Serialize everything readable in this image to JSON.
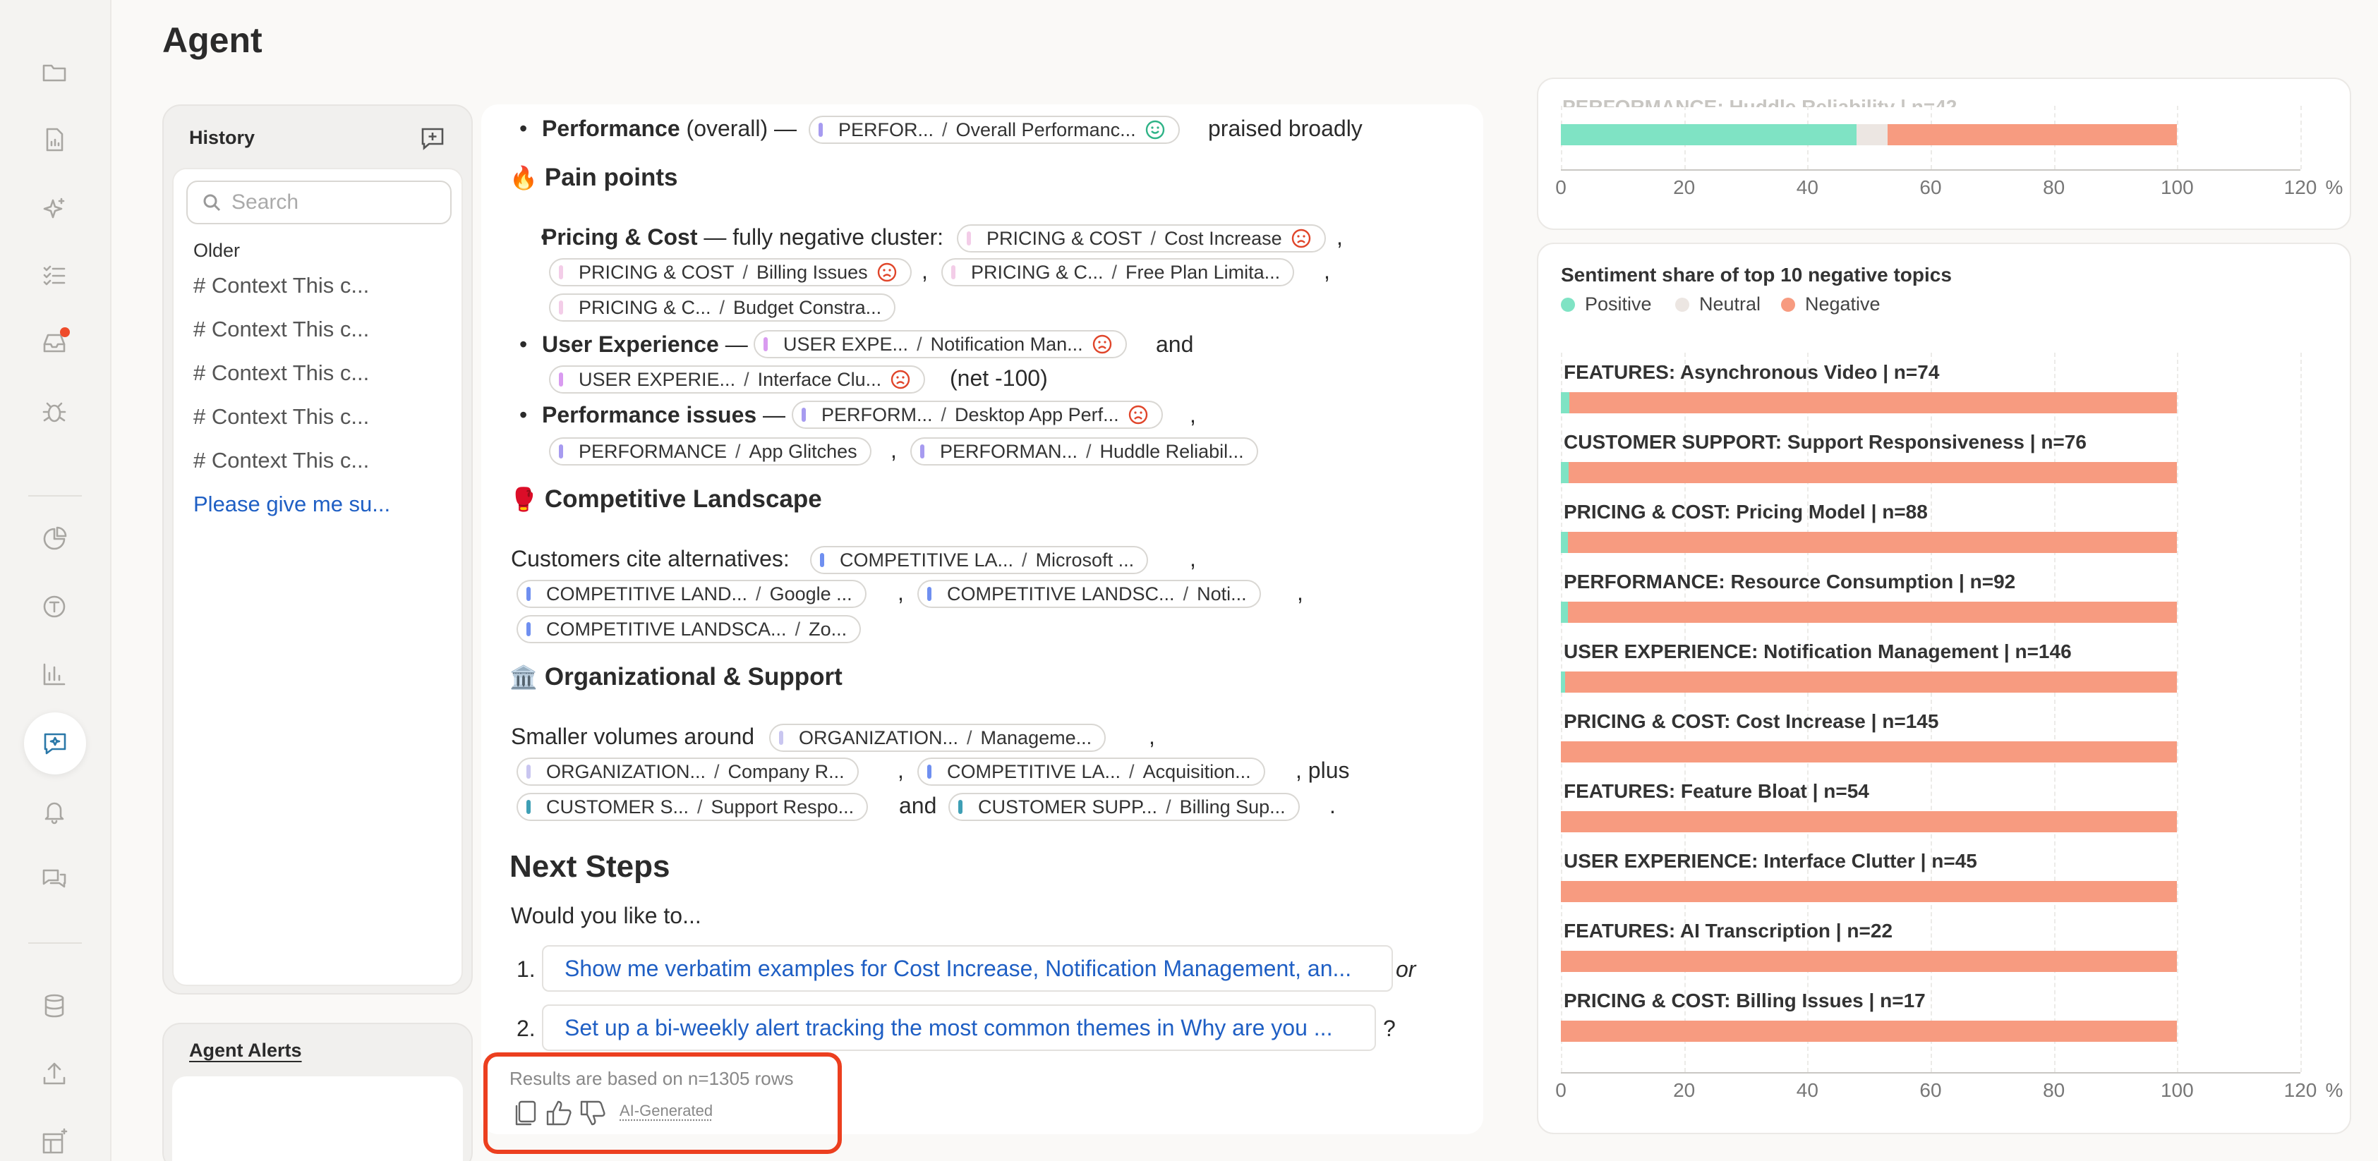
{
  "page_title": "Agent",
  "rail": {
    "icons": [
      "folder-icon",
      "document-chart-icon",
      "sparkles-icon",
      "checklist-icon",
      "inbox-icon",
      "bug-icon",
      "pie-chart-icon",
      "topic-icon",
      "bar-chart-icon",
      "agent-chat-icon",
      "bell-icon",
      "chat-bubbles-icon",
      "database-icon",
      "upload-icon",
      "layout-sparkle-icon"
    ],
    "active": "agent-chat-icon"
  },
  "history": {
    "title": "History",
    "search_placeholder": "Search",
    "group_label": "Older",
    "items": [
      "# Context This c...",
      "# Context This c...",
      "# Context This c...",
      "# Context This c...",
      "# Context This c..."
    ],
    "link_item": "Please give me su..."
  },
  "alerts": {
    "title": "Agent Alerts"
  },
  "chat": {
    "perf_line": {
      "bullet": "Performance",
      "rest": "(overall) —",
      "chip": {
        "category": "PERFOR...",
        "topic": "Overall Performanc...",
        "sentiment": "positive"
      },
      "after": "praised broadly"
    },
    "pain_heading": {
      "emoji": "🔥",
      "text": "Pain points"
    },
    "pricing": {
      "lead": "Pricing & Cost",
      "rest": "— fully negative cluster:",
      "chips": [
        {
          "category": "PRICING & COST",
          "topic": "Cost Increase",
          "sentiment": "negative"
        },
        {
          "category": "PRICING & COST",
          "topic": "Billing Issues",
          "sentiment": "negative"
        },
        {
          "category": "PRICING & C...",
          "topic": "Free Plan Limita...",
          "sentiment": ""
        },
        {
          "category": "PRICING & C...",
          "topic": "Budget Constra...",
          "sentiment": ""
        }
      ]
    },
    "ux": {
      "lead": "User Experience",
      "rest": "—",
      "and": "and",
      "net": "(net -100)",
      "chips": [
        {
          "category": "USER EXPE...",
          "topic": "Notification Man...",
          "sentiment": "negative"
        },
        {
          "category": "USER EXPERIE...",
          "topic": "Interface Clu...",
          "sentiment": "negative"
        }
      ]
    },
    "perf_issues": {
      "lead": "Performance issues",
      "rest": "—",
      "chips": [
        {
          "category": "PERFORM...",
          "topic": "Desktop App Perf...",
          "sentiment": "negative"
        },
        {
          "category": "PERFORMANCE",
          "topic": "App Glitches",
          "sentiment": ""
        },
        {
          "category": "PERFORMAN...",
          "topic": "Huddle Reliabil...",
          "sentiment": ""
        }
      ]
    },
    "comp_heading": {
      "emoji": "🥊",
      "text": "Competitive Landscape"
    },
    "comp": {
      "lead": "Customers cite alternatives:",
      "chips": [
        {
          "category": "COMPETITIVE LA...",
          "topic": "Microsoft ..."
        },
        {
          "category": "COMPETITIVE LAND...",
          "topic": "Google ..."
        },
        {
          "category": "COMPETITIVE LANDSC...",
          "topic": "Noti..."
        },
        {
          "category": "COMPETITIVE LANDSCA...",
          "topic": "Zo..."
        }
      ]
    },
    "org_heading": {
      "emoji": "🏛️",
      "text": "Organizational & Support"
    },
    "org": {
      "lead": "Smaller volumes around",
      "plus": ", plus",
      "and": "and",
      "chips": [
        {
          "category": "ORGANIZATION...",
          "topic": "Manageme..."
        },
        {
          "category": "ORGANIZATION...",
          "topic": "Company R..."
        },
        {
          "category": "COMPETITIVE LA...",
          "topic": "Acquisition..."
        },
        {
          "category": "CUSTOMER S...",
          "topic": "Support Respo..."
        },
        {
          "category": "CUSTOMER SUPP...",
          "topic": "Billing Sup..."
        }
      ]
    },
    "next_steps": {
      "heading": "Next Steps",
      "prompt": "Would you like to...",
      "items": [
        {
          "num": "1.",
          "text": "Show me verbatim examples for Cost Increase, Notification Management, an...",
          "after": "or"
        },
        {
          "num": "2.",
          "text": "Set up a bi-weekly alert tracking the most common themes in Why are you ...",
          "after": "?"
        }
      ]
    },
    "results_note": "Results are based on n=1305 rows",
    "ai_label": "AI-Generated"
  },
  "top_chart": {
    "partial_label": "PERFORMANCE: Huddle Reliability | n=42",
    "series": {
      "positive": 48,
      "neutral": 5,
      "negative": 47
    },
    "x_ticks": [
      "0",
      "20",
      "40",
      "60",
      "80",
      "100",
      "120"
    ],
    "x_unit": "%"
  },
  "chart_data": {
    "type": "bar",
    "title": "Sentiment share of top 10 negative topics",
    "legend": [
      "Positive",
      "Neutral",
      "Negative"
    ],
    "colors": {
      "positive": "#7fe3c4",
      "neutral": "#ece6e2",
      "negative": "#f79b80"
    },
    "categories": [
      "FEATURES: Asynchronous Video | n=74",
      "CUSTOMER SUPPORT: Support Responsiveness | n=76",
      "PRICING & COST: Pricing Model | n=88",
      "PERFORMANCE: Resource Consumption | n=92",
      "USER EXPERIENCE: Notification Management | n=146",
      "PRICING & COST: Cost Increase | n=145",
      "FEATURES: Feature Bloat | n=54",
      "USER EXPERIENCE: Interface Clutter | n=45",
      "FEATURES: AI Transcription | n=22",
      "PRICING & COST: Billing Issues | n=17"
    ],
    "series": [
      {
        "name": "Positive",
        "values": [
          1.4,
          1.3,
          1.1,
          1.1,
          0.7,
          0,
          0,
          0,
          0,
          0
        ]
      },
      {
        "name": "Neutral",
        "values": [
          0,
          0,
          0,
          0,
          0,
          0,
          0,
          0,
          0,
          0
        ]
      },
      {
        "name": "Negative",
        "values": [
          98.6,
          98.7,
          98.9,
          98.9,
          99.3,
          100,
          100,
          100,
          100,
          100
        ]
      }
    ],
    "x_ticks": [
      "0",
      "20",
      "40",
      "60",
      "80",
      "100",
      "120"
    ],
    "x_unit": "%",
    "xlim": [
      0,
      120
    ]
  }
}
